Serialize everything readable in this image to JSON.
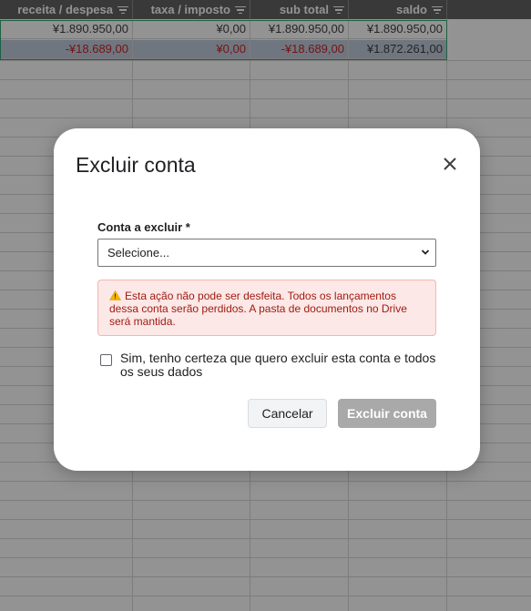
{
  "sheet": {
    "headers": [
      {
        "label": "receita / despesa"
      },
      {
        "label": "taxa / imposto"
      },
      {
        "label": "sub total"
      },
      {
        "label": "saldo"
      }
    ],
    "rows": [
      [
        "¥1.890.950,00",
        "¥0,00",
        "¥1.890.950,00",
        "¥1.890.950,00"
      ],
      [
        "-¥18.689,00",
        "¥0,00",
        "-¥18.689,00",
        "¥1.872.261,00"
      ]
    ],
    "colors": {
      "header_bg": "#4a4a4a",
      "negative_text": "#c00000",
      "selected_row_bg": "#b8c4d6",
      "selection_border": "#0f9d58"
    }
  },
  "dialog": {
    "title": "Excluir conta",
    "close_icon": "close-icon",
    "field_label": "Conta a excluir *",
    "select_value": "Selecione...",
    "warning_icon": "warning-icon",
    "warning_text": "Esta ação não pode ser desfeita. Todos os lançamentos dessa conta serão perdidos. A pasta de documentos no Drive será mantida.",
    "confirm_checkbox_checked": false,
    "confirm_label": "Sim, tenho certeza que quero excluir esta conta e todos os seus dados",
    "cancel_label": "Cancelar",
    "delete_label": "Excluir conta",
    "delete_enabled": false
  }
}
